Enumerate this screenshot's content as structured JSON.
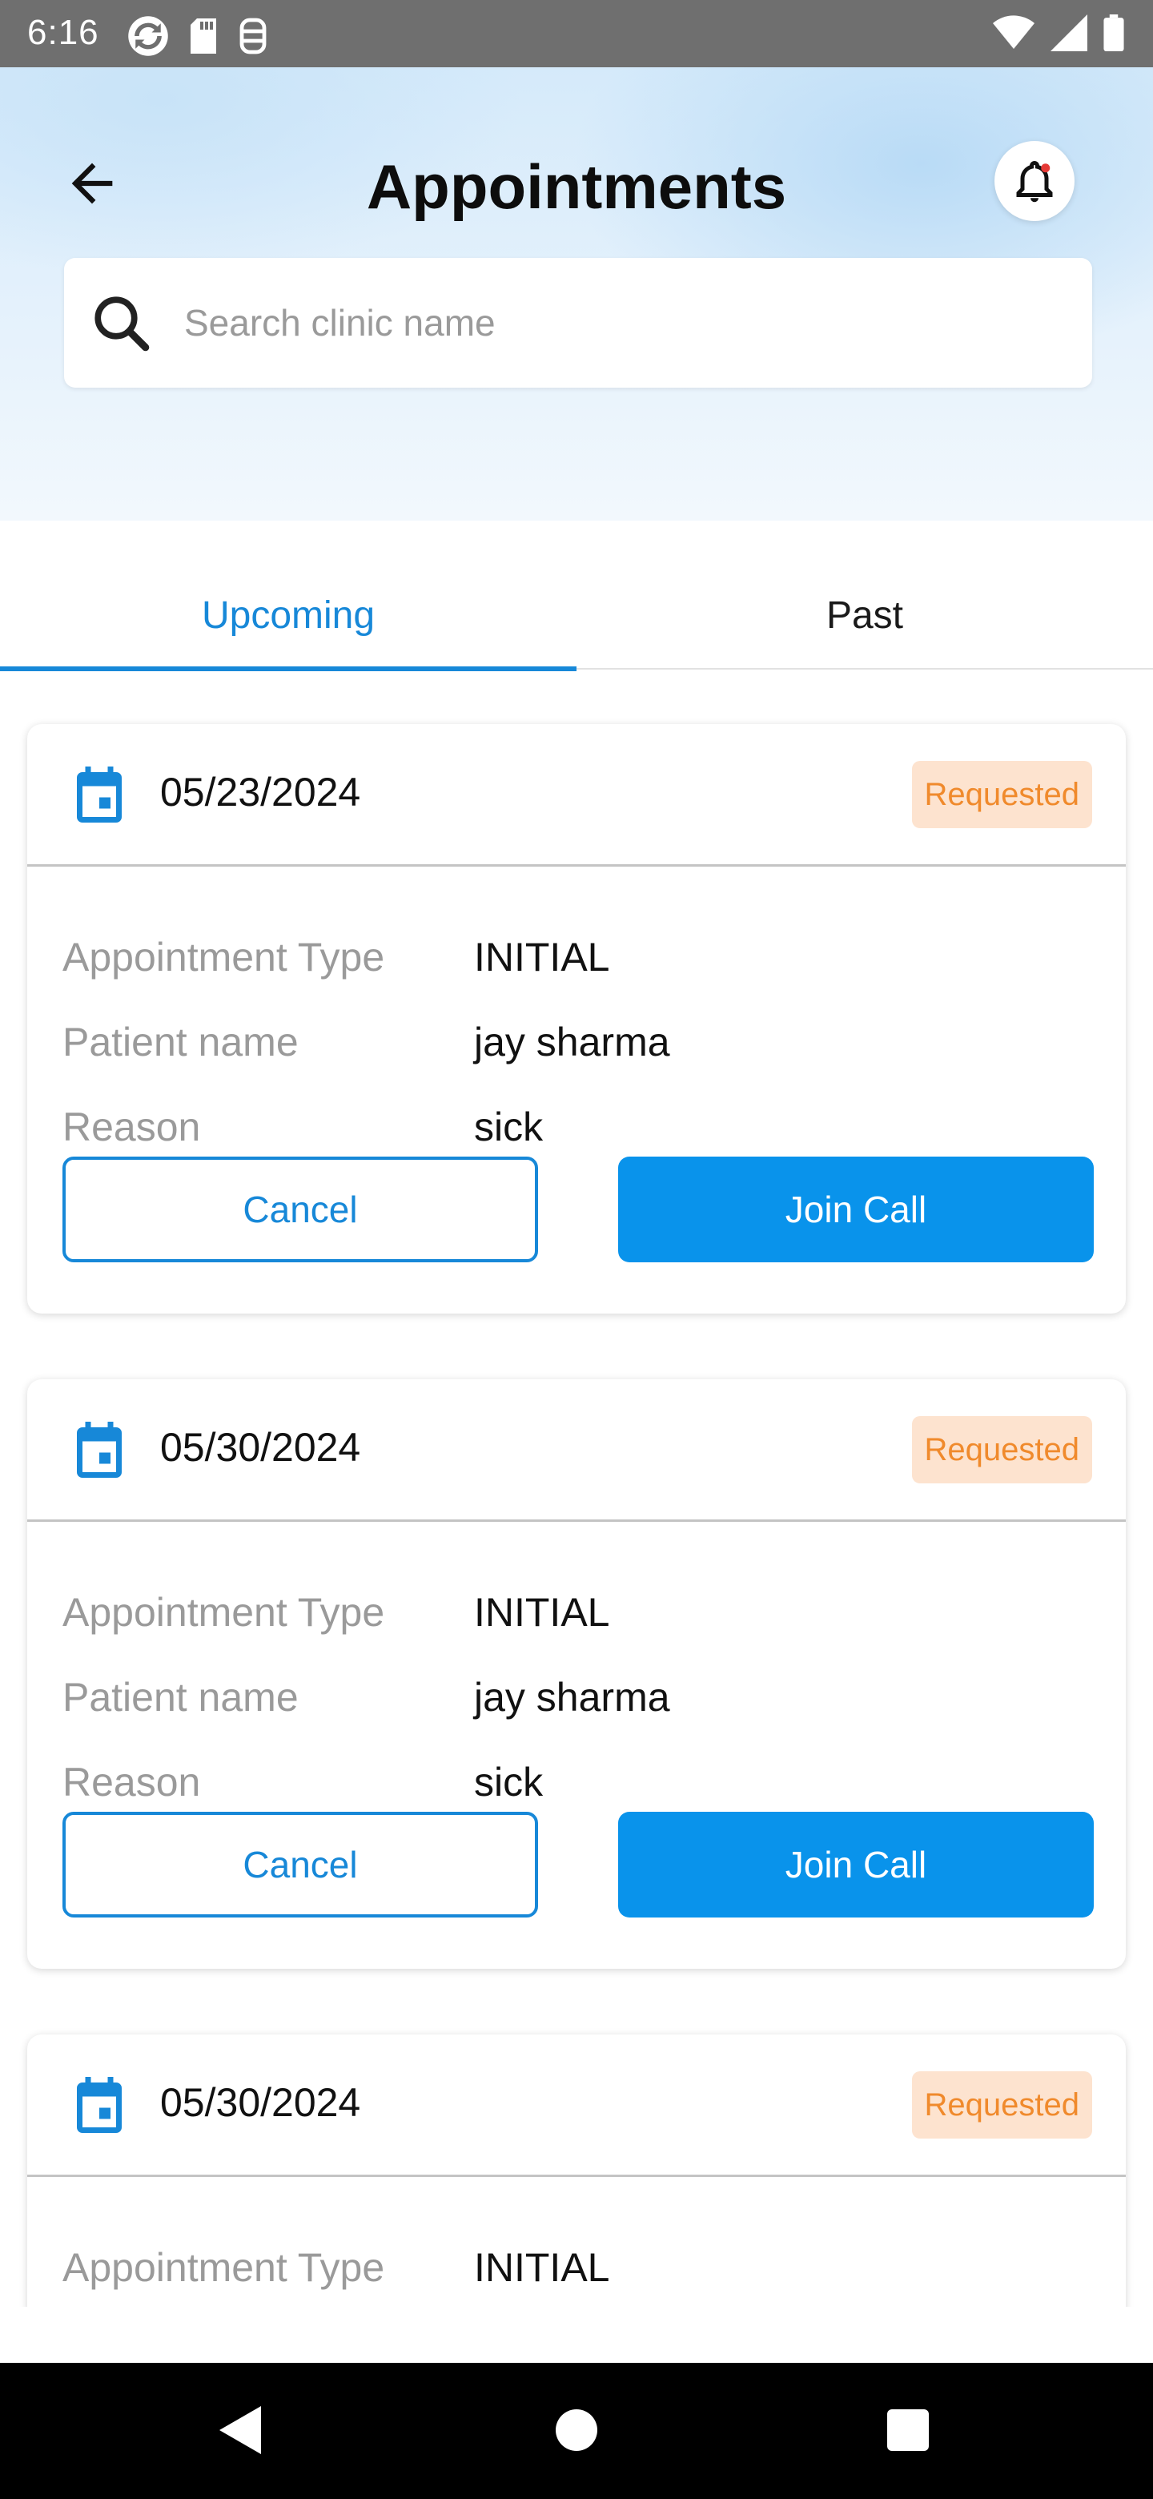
{
  "status_bar": {
    "time": "6:16",
    "left_icons": [
      "sync-icon",
      "sd-card-icon",
      "storage-icon"
    ],
    "right_icons": [
      "wifi-icon",
      "signal-icon",
      "battery-icon"
    ]
  },
  "header": {
    "title": "Appointments",
    "back_icon": "arrow-left-icon",
    "notification_icon": "bell-icon",
    "search": {
      "placeholder": "Search clinic name",
      "value": ""
    }
  },
  "tabs": [
    {
      "label": "Upcoming",
      "active": true
    },
    {
      "label": "Past",
      "active": false
    }
  ],
  "colors": {
    "accent": "#1788d8",
    "primary_button": "#0993eb",
    "badge_bg": "#fde3cf",
    "badge_text": "#f08a2c"
  },
  "appointments": [
    {
      "date": "05/23/2024",
      "status": "Requested",
      "fields": [
        {
          "label": "Appointment Type",
          "value": "INITIAL"
        },
        {
          "label": "Patient name",
          "value": "jay sharma"
        },
        {
          "label": "Reason",
          "value": "sick"
        }
      ],
      "cancel_label": "Cancel",
      "join_label": "Join Call"
    },
    {
      "date": "05/30/2024",
      "status": "Requested",
      "fields": [
        {
          "label": "Appointment Type",
          "value": "INITIAL"
        },
        {
          "label": "Patient name",
          "value": "jay sharma"
        },
        {
          "label": "Reason",
          "value": "sick"
        }
      ],
      "cancel_label": "Cancel",
      "join_label": "Join Call"
    },
    {
      "date": "05/30/2024",
      "status": "Requested",
      "fields": [
        {
          "label": "Appointment Type",
          "value": "INITIAL"
        }
      ]
    }
  ]
}
